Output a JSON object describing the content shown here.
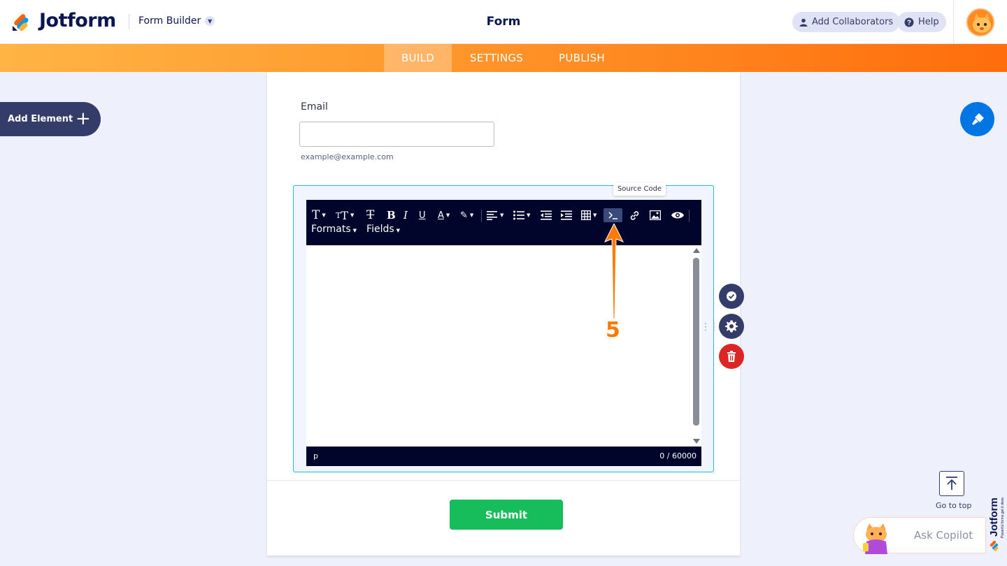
{
  "header": {
    "brand": "Jotform",
    "builder_dropdown": "Form Builder",
    "title": "Form",
    "add_collaborators": "Add Collaborators",
    "help": "Help"
  },
  "nav": {
    "tabs": [
      "BUILD",
      "SETTINGS",
      "PUBLISH"
    ],
    "active": "BUILD"
  },
  "sidebar": {
    "add_element": "Add Element"
  },
  "form": {
    "email_label": "Email",
    "email_sublabel": "example@example.com",
    "submit_label": "Submit"
  },
  "editor": {
    "tooltip": "Source Code",
    "toolbar_row2": [
      "Formats",
      "Fields"
    ],
    "status_path": "p",
    "char_count": "0 / 60000"
  },
  "annotation": {
    "step": "5"
  },
  "widgets": {
    "go_to_top": "Go to top",
    "ask_copilot": "Ask Copilot",
    "jotform_vertical": "Jotform",
    "jotform_tagline": "Powerful forms get it done."
  },
  "colors": {
    "navy": "#0a1551",
    "dark_slate": "#343c6a",
    "orange_start": "#ffb444",
    "orange_end": "#ff6d0c",
    "editor_toolbar": "#01042b",
    "selection_border": "#18bde1",
    "submit_green": "#18bd5b",
    "delete_red": "#dc2626",
    "paint_blue": "#0075e3",
    "annotation_orange": "#ff7a00"
  }
}
